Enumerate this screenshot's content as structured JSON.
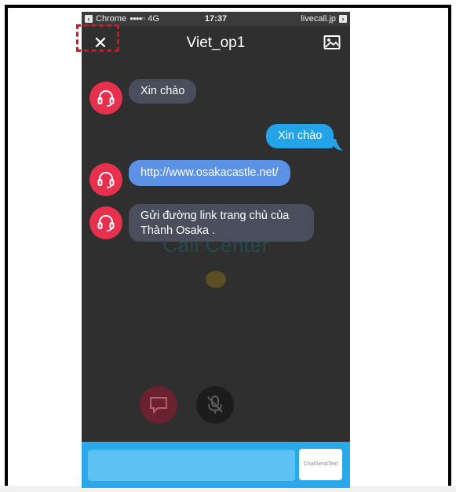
{
  "status_bar": {
    "back_app": "Chrome",
    "signal": "●●●●○",
    "network": "4G",
    "time": "17:37",
    "site": "livecall.jp"
  },
  "header": {
    "close_label": "✕",
    "title": "Viet_op1",
    "image_icon": "image-icon"
  },
  "background": {
    "brand_text": "Call Center"
  },
  "messages": [
    {
      "sender": "operator",
      "text": "Xin chào"
    },
    {
      "sender": "user",
      "text": "Xin chào"
    },
    {
      "sender": "operator",
      "text": "http://www.osakacastle.net/"
    },
    {
      "sender": "operator",
      "text": "Gửi đường link trang chủ của Thành Osaka ."
    }
  ],
  "composer": {
    "input_value": "",
    "send_label": "ChatSendText"
  },
  "colors": {
    "highlight": "#e0101a",
    "operator_avatar": "#e6304e",
    "user_bubble": "#23a3e8",
    "input_bar": "#2aa8ea"
  }
}
